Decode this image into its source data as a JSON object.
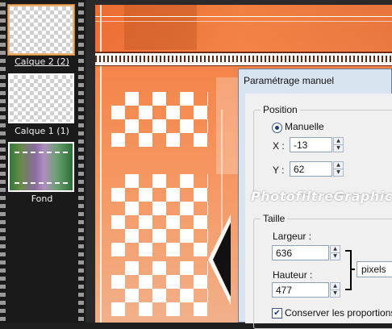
{
  "layers": [
    {
      "label": "Calque 2 (2)",
      "selected": true
    },
    {
      "label": "Calque 1 (1)",
      "selected": false
    },
    {
      "label": "Fond",
      "selected": false
    }
  ],
  "dialog": {
    "title": "Paramétrage manuel",
    "position": {
      "title": "Position",
      "mode_label": "Manuelle",
      "x_label": "X :",
      "x_value": "-13",
      "y_label": "Y :",
      "y_value": "62"
    },
    "size": {
      "title": "Taille",
      "width_label": "Largeur :",
      "width_value": "636",
      "height_label": "Hauteur :",
      "height_value": "477",
      "unit": "pixels",
      "keep_ratio_label": "Conserver les proportions",
      "keep_ratio_checked": true
    }
  },
  "watermark": "PhotofiltreGraphic"
}
